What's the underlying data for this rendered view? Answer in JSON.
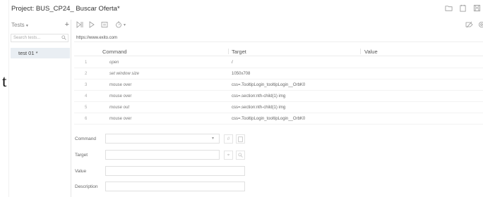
{
  "page": {
    "stray_character": "t"
  },
  "titlebar": {
    "project_label": "Project:  BUS_CP24_ Buscar Oferta*",
    "icons": [
      "folder-icon",
      "open-file-icon",
      "save-icon"
    ]
  },
  "sidebar": {
    "tests_label": "Tests",
    "tests_caret": "▾",
    "add_label": "+",
    "search_placeholder": "Search tests...",
    "items": [
      {
        "label": "test 01 *",
        "selected": true
      }
    ]
  },
  "toolbar": {
    "icons": [
      "run-all-icon",
      "run-current-icon",
      "pause-icon",
      "timer-icon",
      "disable-breakpoints-icon",
      "settings-icon"
    ],
    "timer_caret": "▾"
  },
  "url_bar": {
    "value": "https://www.exito.com"
  },
  "grid": {
    "headers": {
      "command": "Command",
      "target": "Target",
      "value": "Value"
    },
    "rows": [
      {
        "num": "1",
        "command": "open",
        "target": "/",
        "value": ""
      },
      {
        "num": "2",
        "command": "set window size",
        "target": "1050x708",
        "value": ""
      },
      {
        "num": "3",
        "command": "mouse over",
        "target": "css=.TooltipLogin_tooltipLogin__OrbK0",
        "value": ""
      },
      {
        "num": "4",
        "command": "mouse over",
        "target": "css=.section:nth-child(1) img",
        "value": ""
      },
      {
        "num": "5",
        "command": "mouse out",
        "target": "css=.section:nth-child(1) img",
        "value": ""
      },
      {
        "num": "6",
        "command": "mouse over",
        "target": "css=.TooltipLogin_tooltipLogin__OrbK0",
        "value": ""
      }
    ]
  },
  "editor": {
    "command_label": "Command",
    "target_label": "Target",
    "value_label": "Value",
    "description_label": "Description",
    "command_value": "",
    "target_value": "",
    "value_value": "",
    "description_value": "",
    "command_caret": "▾",
    "disable_label": "//",
    "reference_icon": "reference-icon",
    "select_target_label": "⌖",
    "find_target_icon": "search-icon"
  }
}
